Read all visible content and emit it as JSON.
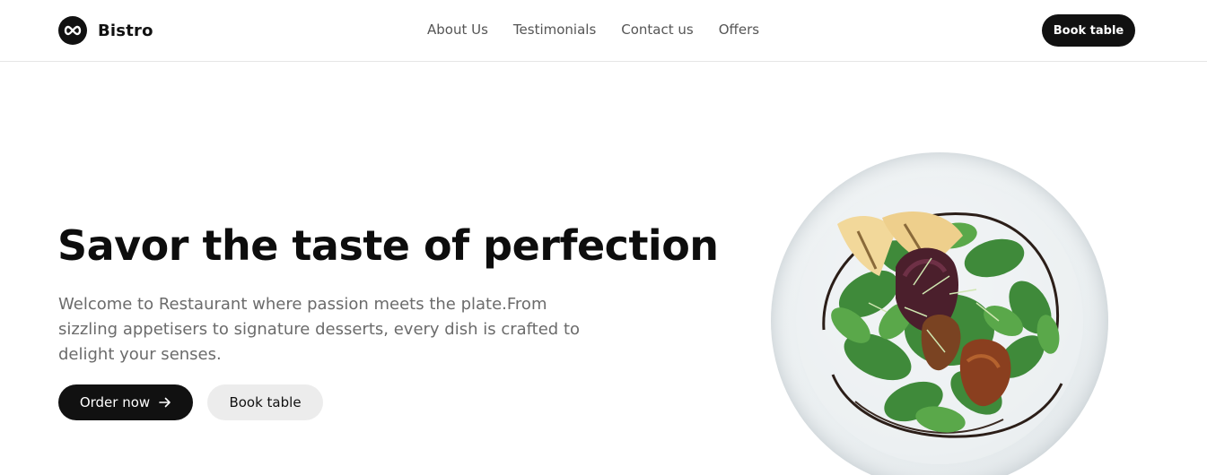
{
  "header": {
    "brand": {
      "name": "Bistro",
      "logo_icon": "infinity-logo-icon"
    },
    "nav": [
      {
        "label": "About Us"
      },
      {
        "label": "Testimonials"
      },
      {
        "label": "Contact us"
      },
      {
        "label": "Offers"
      }
    ],
    "cta_label": "Book table"
  },
  "hero": {
    "title": "Savor the taste of perfection",
    "description": "Welcome to Restaurant where passion meets the plate.From sizzling appetisers to signature desserts, every dish is crafted to delight your senses.",
    "order_button": {
      "label": "Order now",
      "icon": "arrow-right-icon"
    },
    "book_button": {
      "label": "Book table"
    },
    "image": "salad-plate-image"
  },
  "colors": {
    "primary": "#111111",
    "secondary_button": "#ececec",
    "muted_text": "#6b6b6b",
    "nav_text": "#555555",
    "background": "#ffffff"
  }
}
